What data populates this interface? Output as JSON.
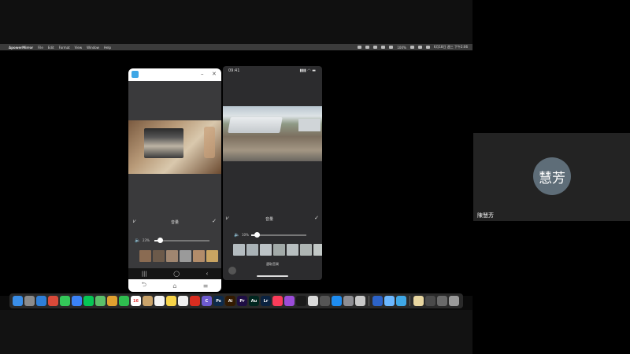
{
  "menubar": {
    "apple": "",
    "app_name": "ApowerMirror",
    "items": [
      "File",
      "Edit",
      "Format",
      "View",
      "Window",
      "Help"
    ],
    "battery": "100%",
    "clock": "6月18日 週三 下午2:06"
  },
  "android": {
    "window_controls": {
      "minimize": "–",
      "close": "✕"
    },
    "toolbar": {
      "left_icon": "⩗",
      "title": "音量",
      "confirm": "✓"
    },
    "volume": {
      "icon": "🔈",
      "value": "23%",
      "level": 0.1
    },
    "caption": "選取音樂",
    "navbar": {
      "recent": "|||",
      "home": "◯",
      "back": "‹"
    },
    "bottom": {
      "back": "⮌",
      "home": "⌂",
      "menu": "≡"
    },
    "thumb_colors": [
      "#8a6b52",
      "#6c5a4a",
      "#a08670",
      "#9a9a9a",
      "#b28c6a",
      "#c9a462"
    ]
  },
  "iphone": {
    "status_time": "09:41",
    "status_icons": "▮▮▮ ◠ ▬",
    "toolbar": {
      "left_icon": "⩗",
      "title": "音量",
      "confirm": "✓"
    },
    "volume": {
      "icon": "🔈",
      "value": "10%",
      "level": 0.1
    },
    "caption": "選取音樂",
    "thumb_colors": [
      "#b4bcc0",
      "#a9b2b6",
      "#bcc3c6",
      "#a2aaa8",
      "#b8bfc0",
      "#aeb5b3",
      "#c2c8c6"
    ]
  },
  "dock": {
    "apps": [
      {
        "name": "finder-icon",
        "color": "#3a8ee8",
        "label": ""
      },
      {
        "name": "launchpad-icon",
        "color": "#8b8b8b",
        "label": ""
      },
      {
        "name": "safari-icon",
        "color": "#2f7fd8",
        "label": ""
      },
      {
        "name": "chrome-icon",
        "color": "#d94a3a",
        "label": ""
      },
      {
        "name": "messages-icon",
        "color": "#34c759",
        "label": ""
      },
      {
        "name": "mail-icon",
        "color": "#3b82f6",
        "label": ""
      },
      {
        "name": "line-icon",
        "color": "#06c755",
        "label": ""
      },
      {
        "name": "maps-icon",
        "color": "#5bbf6a",
        "label": ""
      },
      {
        "name": "photos-icon",
        "color": "#e0a030",
        "label": ""
      },
      {
        "name": "facetime-icon",
        "color": "#2fbd4f",
        "label": ""
      },
      {
        "name": "calendar-icon",
        "color": "#ffffff",
        "label": "16"
      },
      {
        "name": "contacts-icon",
        "color": "#c9a36a",
        "label": ""
      },
      {
        "name": "reminders-icon",
        "color": "#f4f4f4",
        "label": ""
      },
      {
        "name": "notes-icon",
        "color": "#f7d448",
        "label": ""
      },
      {
        "name": "freeform-icon",
        "color": "#efefef",
        "label": ""
      },
      {
        "name": "acrobat-icon",
        "color": "#d92d20",
        "label": ""
      },
      {
        "name": "canva-icon",
        "color": "#6d5bd0",
        "label": "C"
      },
      {
        "name": "photoshop-icon",
        "color": "#0d2a4a",
        "label": "Ps"
      },
      {
        "name": "illustrator-icon",
        "color": "#331a00",
        "label": "Ai"
      },
      {
        "name": "premiere-icon",
        "color": "#1f0e44",
        "label": "Pr"
      },
      {
        "name": "audition-icon",
        "color": "#00261f",
        "label": "Au"
      },
      {
        "name": "lightroom-icon",
        "color": "#0a2240",
        "label": "Lr"
      },
      {
        "name": "music-icon",
        "color": "#fa3c5a",
        "label": ""
      },
      {
        "name": "podcasts-icon",
        "color": "#9b4cd9",
        "label": ""
      },
      {
        "name": "tv-icon",
        "color": "#1a1a1a",
        "label": ""
      },
      {
        "name": "grid-app-icon",
        "color": "#d9d9d9",
        "label": ""
      },
      {
        "name": "calculator-icon",
        "color": "#555555",
        "label": ""
      },
      {
        "name": "appstore-icon",
        "color": "#1e8cf0",
        "label": ""
      },
      {
        "name": "settings-icon",
        "color": "#8e8e93",
        "label": ""
      },
      {
        "name": "preview-icon",
        "color": "#c8c8c8",
        "label": ""
      }
    ],
    "apps_right": [
      {
        "name": "quicktime-icon",
        "color": "#2c63c8",
        "label": ""
      },
      {
        "name": "screenshot-icon",
        "color": "#6bb7ff",
        "label": ""
      },
      {
        "name": "apowermirror-icon",
        "color": "#3fa7e6",
        "label": ""
      }
    ],
    "apps_tray": [
      {
        "name": "folder-icon",
        "color": "#e8d6a0",
        "label": ""
      },
      {
        "name": "screen-record-icon",
        "color": "#4a4a4a",
        "label": ""
      },
      {
        "name": "window-icon",
        "color": "#6a6a6a",
        "label": ""
      },
      {
        "name": "trash-icon",
        "color": "#9a9a9a",
        "label": ""
      }
    ]
  },
  "participant": {
    "avatar_text": "慧芳",
    "name": "陳慧芳"
  }
}
